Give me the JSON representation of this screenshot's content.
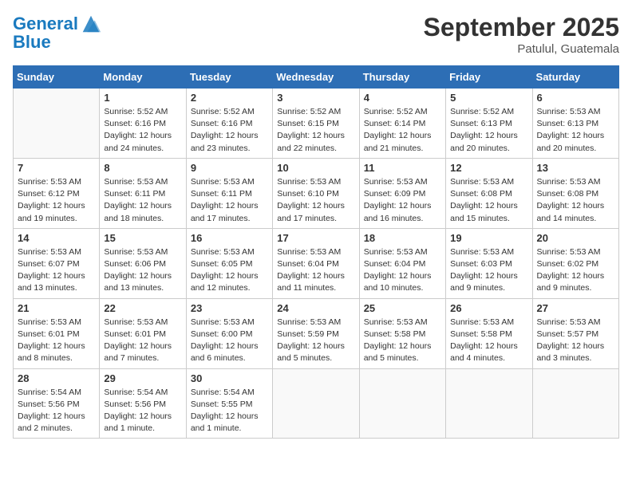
{
  "header": {
    "logo_line1": "General",
    "logo_line2": "Blue",
    "month": "September 2025",
    "location": "Patulul, Guatemala"
  },
  "weekdays": [
    "Sunday",
    "Monday",
    "Tuesday",
    "Wednesday",
    "Thursday",
    "Friday",
    "Saturday"
  ],
  "weeks": [
    [
      {
        "day": "",
        "info": ""
      },
      {
        "day": "1",
        "info": "Sunrise: 5:52 AM\nSunset: 6:16 PM\nDaylight: 12 hours\nand 24 minutes."
      },
      {
        "day": "2",
        "info": "Sunrise: 5:52 AM\nSunset: 6:16 PM\nDaylight: 12 hours\nand 23 minutes."
      },
      {
        "day": "3",
        "info": "Sunrise: 5:52 AM\nSunset: 6:15 PM\nDaylight: 12 hours\nand 22 minutes."
      },
      {
        "day": "4",
        "info": "Sunrise: 5:52 AM\nSunset: 6:14 PM\nDaylight: 12 hours\nand 21 minutes."
      },
      {
        "day": "5",
        "info": "Sunrise: 5:52 AM\nSunset: 6:13 PM\nDaylight: 12 hours\nand 20 minutes."
      },
      {
        "day": "6",
        "info": "Sunrise: 5:53 AM\nSunset: 6:13 PM\nDaylight: 12 hours\nand 20 minutes."
      }
    ],
    [
      {
        "day": "7",
        "info": "Sunrise: 5:53 AM\nSunset: 6:12 PM\nDaylight: 12 hours\nand 19 minutes."
      },
      {
        "day": "8",
        "info": "Sunrise: 5:53 AM\nSunset: 6:11 PM\nDaylight: 12 hours\nand 18 minutes."
      },
      {
        "day": "9",
        "info": "Sunrise: 5:53 AM\nSunset: 6:11 PM\nDaylight: 12 hours\nand 17 minutes."
      },
      {
        "day": "10",
        "info": "Sunrise: 5:53 AM\nSunset: 6:10 PM\nDaylight: 12 hours\nand 17 minutes."
      },
      {
        "day": "11",
        "info": "Sunrise: 5:53 AM\nSunset: 6:09 PM\nDaylight: 12 hours\nand 16 minutes."
      },
      {
        "day": "12",
        "info": "Sunrise: 5:53 AM\nSunset: 6:08 PM\nDaylight: 12 hours\nand 15 minutes."
      },
      {
        "day": "13",
        "info": "Sunrise: 5:53 AM\nSunset: 6:08 PM\nDaylight: 12 hours\nand 14 minutes."
      }
    ],
    [
      {
        "day": "14",
        "info": "Sunrise: 5:53 AM\nSunset: 6:07 PM\nDaylight: 12 hours\nand 13 minutes."
      },
      {
        "day": "15",
        "info": "Sunrise: 5:53 AM\nSunset: 6:06 PM\nDaylight: 12 hours\nand 13 minutes."
      },
      {
        "day": "16",
        "info": "Sunrise: 5:53 AM\nSunset: 6:05 PM\nDaylight: 12 hours\nand 12 minutes."
      },
      {
        "day": "17",
        "info": "Sunrise: 5:53 AM\nSunset: 6:04 PM\nDaylight: 12 hours\nand 11 minutes."
      },
      {
        "day": "18",
        "info": "Sunrise: 5:53 AM\nSunset: 6:04 PM\nDaylight: 12 hours\nand 10 minutes."
      },
      {
        "day": "19",
        "info": "Sunrise: 5:53 AM\nSunset: 6:03 PM\nDaylight: 12 hours\nand 9 minutes."
      },
      {
        "day": "20",
        "info": "Sunrise: 5:53 AM\nSunset: 6:02 PM\nDaylight: 12 hours\nand 9 minutes."
      }
    ],
    [
      {
        "day": "21",
        "info": "Sunrise: 5:53 AM\nSunset: 6:01 PM\nDaylight: 12 hours\nand 8 minutes."
      },
      {
        "day": "22",
        "info": "Sunrise: 5:53 AM\nSunset: 6:01 PM\nDaylight: 12 hours\nand 7 minutes."
      },
      {
        "day": "23",
        "info": "Sunrise: 5:53 AM\nSunset: 6:00 PM\nDaylight: 12 hours\nand 6 minutes."
      },
      {
        "day": "24",
        "info": "Sunrise: 5:53 AM\nSunset: 5:59 PM\nDaylight: 12 hours\nand 5 minutes."
      },
      {
        "day": "25",
        "info": "Sunrise: 5:53 AM\nSunset: 5:58 PM\nDaylight: 12 hours\nand 5 minutes."
      },
      {
        "day": "26",
        "info": "Sunrise: 5:53 AM\nSunset: 5:58 PM\nDaylight: 12 hours\nand 4 minutes."
      },
      {
        "day": "27",
        "info": "Sunrise: 5:53 AM\nSunset: 5:57 PM\nDaylight: 12 hours\nand 3 minutes."
      }
    ],
    [
      {
        "day": "28",
        "info": "Sunrise: 5:54 AM\nSunset: 5:56 PM\nDaylight: 12 hours\nand 2 minutes."
      },
      {
        "day": "29",
        "info": "Sunrise: 5:54 AM\nSunset: 5:56 PM\nDaylight: 12 hours\nand 1 minute."
      },
      {
        "day": "30",
        "info": "Sunrise: 5:54 AM\nSunset: 5:55 PM\nDaylight: 12 hours\nand 1 minute."
      },
      {
        "day": "",
        "info": ""
      },
      {
        "day": "",
        "info": ""
      },
      {
        "day": "",
        "info": ""
      },
      {
        "day": "",
        "info": ""
      }
    ]
  ]
}
